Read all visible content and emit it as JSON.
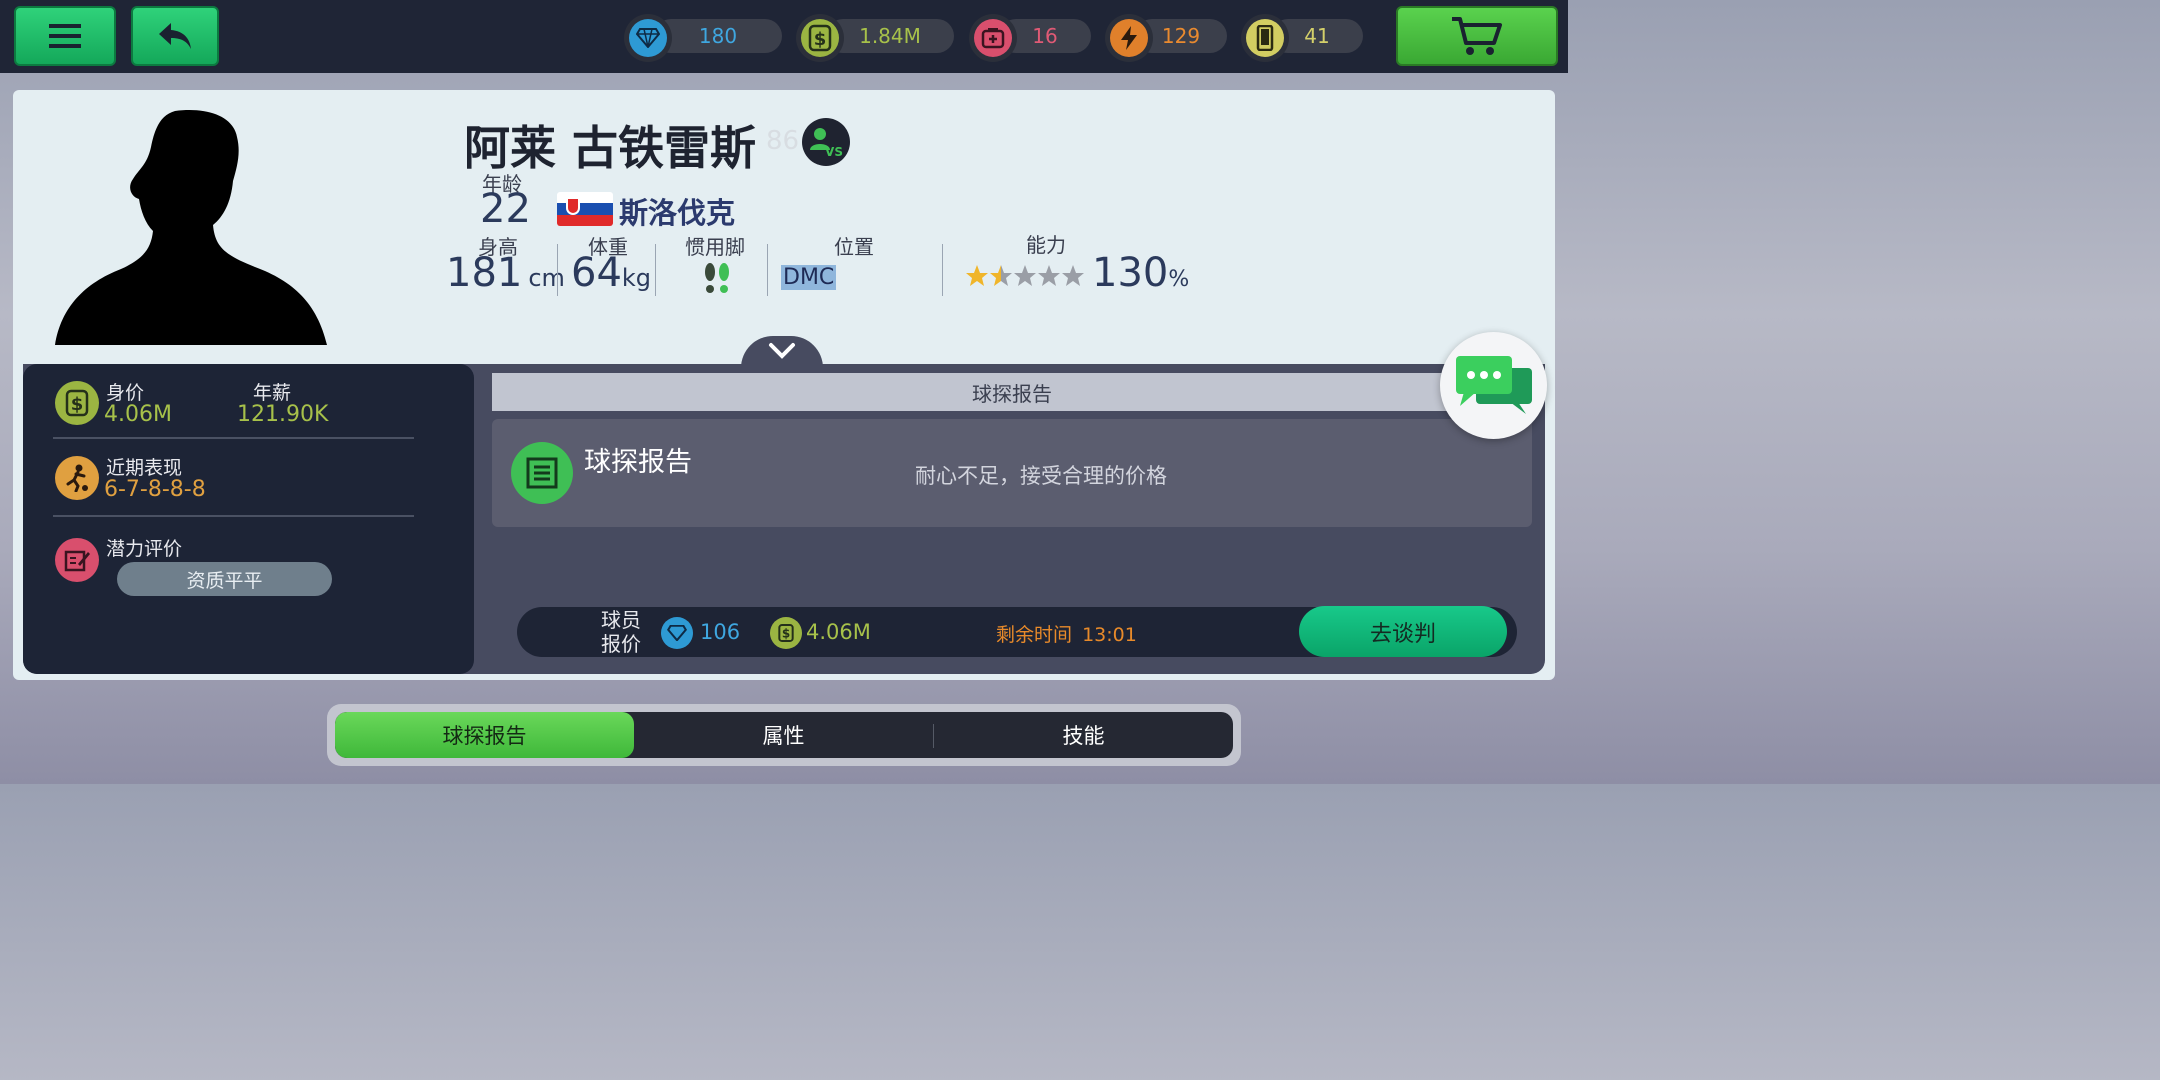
{
  "topbar": {
    "resources": [
      {
        "icon": "diamond-icon",
        "value": "180",
        "color": "#3fa7e0"
      },
      {
        "icon": "dollar-icon",
        "value": "1.84M",
        "color": "#a7c14a"
      },
      {
        "icon": "medkit-icon",
        "value": "16",
        "color": "#e05a75"
      },
      {
        "icon": "lightning-icon",
        "value": "129",
        "color": "#e98a2f"
      },
      {
        "icon": "phone-icon",
        "value": "41",
        "color": "#d4d06a"
      }
    ]
  },
  "player": {
    "name": "阿莱 古铁雷斯",
    "faded_rating": "86",
    "age_label": "年龄",
    "age": "22",
    "nationality": "斯洛伐克",
    "height_label": "身高",
    "height": "181",
    "height_unit": "cm",
    "weight_label": "体重",
    "weight": "64",
    "weight_unit": "kg",
    "foot_label": "惯用脚",
    "position_label": "位置",
    "position": "DMC",
    "ability_label": "能力",
    "stars": 1.5,
    "ability": "130",
    "ability_unit": "%"
  },
  "left_panel": {
    "value_label": "身价",
    "value": "4.06M",
    "salary_label": "年薪",
    "salary": "121.90K",
    "form_label": "近期表现",
    "form": "6-7-8-8-8",
    "potential_label": "潜力评价",
    "potential": "资质平平"
  },
  "report": {
    "header": "球探报告",
    "title": "球探报告",
    "text": "耐心不足，接受合理的价格"
  },
  "offer": {
    "label_line1": "球员",
    "label_line2": "报价",
    "diamonds": "106",
    "cash": "4.06M",
    "time_label": "剩余时间",
    "time": "13:01",
    "negotiate_button": "去谈判"
  },
  "tabs": [
    "球探报告",
    "属性",
    "技能"
  ],
  "colors": {
    "accent_green": "#2fc36a",
    "money": "#a7c14a",
    "form": "#e0a040",
    "timer": "#e88a2a",
    "diamond": "#3fa7e0"
  }
}
